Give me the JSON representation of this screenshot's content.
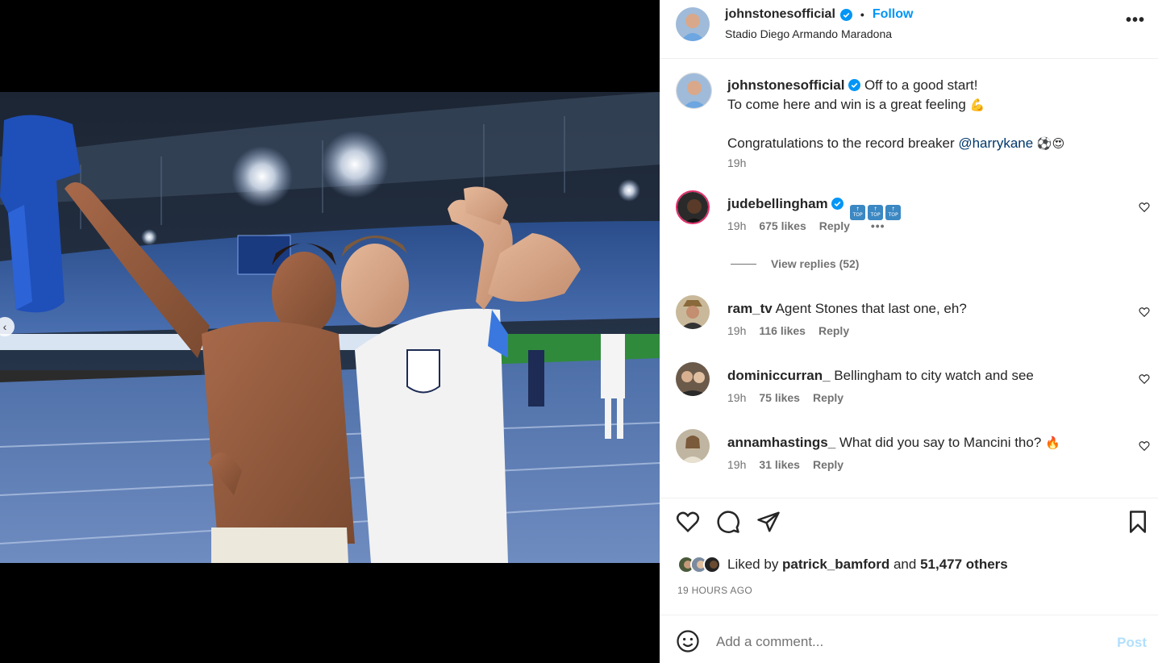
{
  "post": {
    "username": "johnstonesofficial",
    "follow_label": "Follow",
    "location": "Stadio Diego Armando Maradona",
    "more_label": "•••"
  },
  "caption": {
    "username": "johnstonesofficial",
    "line1": "Off to a good start!",
    "line2": "To come here and win is a great feeling",
    "line2_emoji": "💪",
    "line3": "Congratulations to the record breaker ",
    "mention": "@harrykane",
    "line3_emoji": "⚽😍",
    "time": "19h"
  },
  "comments": [
    {
      "username": "judebellingham",
      "text": "",
      "badge_text": "TOP",
      "time": "19h",
      "likes": "675 likes",
      "reply": "Reply",
      "more": "•••",
      "view_replies": "View replies (52)"
    },
    {
      "username": "ram_tv",
      "text": "Agent Stones that last one, eh?",
      "time": "19h",
      "likes": "116 likes",
      "reply": "Reply"
    },
    {
      "username": "dominiccurran_",
      "text": "Bellingham to city watch and see",
      "time": "19h",
      "likes": "75 likes",
      "reply": "Reply"
    },
    {
      "username": "annamhastings_",
      "text": "What did you say to Mancini tho?",
      "emoji": "🔥",
      "time": "19h",
      "likes": "31 likes",
      "reply": "Reply"
    }
  ],
  "likes": {
    "prefix": "Liked by ",
    "user": "patrick_bamford",
    "middle": " and ",
    "others": "51,477 others"
  },
  "timestamp": "19 HOURS AGO",
  "add_comment": {
    "placeholder": "Add a comment...",
    "post_label": "Post"
  },
  "colors": {
    "accent": "#0095f6",
    "verified": "#0095f6",
    "mention": "#00376b",
    "muted": "#737373",
    "post_disabled": "#b2dffc"
  },
  "icons": [
    "verified-icon",
    "more-icon",
    "heart-icon",
    "comment-icon",
    "share-icon",
    "bookmark-icon",
    "emoji-icon",
    "chevron-left-icon"
  ]
}
